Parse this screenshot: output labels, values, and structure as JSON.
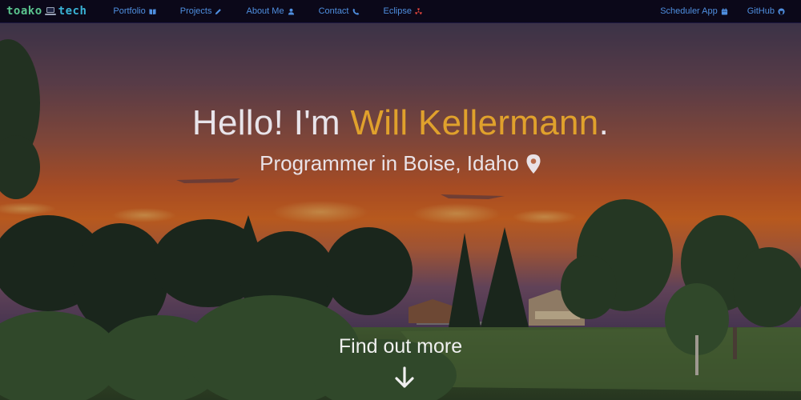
{
  "brand": {
    "part_a": "toako",
    "part_b": "tech"
  },
  "nav": {
    "left": [
      {
        "label": "Portfolio",
        "icon": "book-icon"
      },
      {
        "label": "Projects",
        "icon": "pencil-icon"
      },
      {
        "label": "About Me",
        "icon": "user-icon"
      },
      {
        "label": "Contact",
        "icon": "phone-icon"
      },
      {
        "label": "Eclipse",
        "icon": "radiation-icon"
      }
    ],
    "right": [
      {
        "label": "Scheduler App",
        "icon": "calendar-icon"
      },
      {
        "label": "GitHub",
        "icon": "github-icon"
      }
    ]
  },
  "hero": {
    "greeting": "Hello! I'm ",
    "name": "Will Kellermann",
    "period": ".",
    "subtitle": "Programmer in Boise, Idaho",
    "cta": "Find out more"
  },
  "colors": {
    "nav_bg": "#0b0819",
    "nav_link": "#4f8fe0",
    "name_accent": "#e0a12c",
    "eclipse_icon": "#e0443c"
  }
}
